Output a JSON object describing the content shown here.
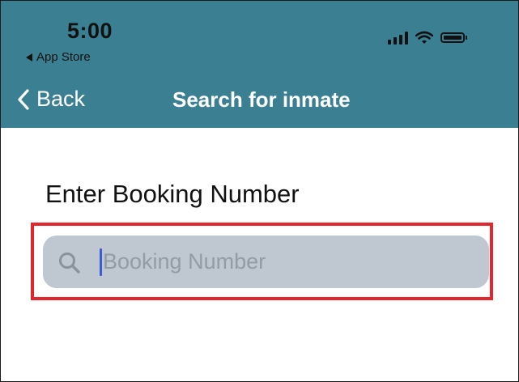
{
  "status_bar": {
    "time": "5:00",
    "back_app": "App Store"
  },
  "nav": {
    "back_label": "Back",
    "title": "Search for inmate"
  },
  "form": {
    "label": "Enter Booking Number",
    "search_placeholder": "Booking Number",
    "search_value": ""
  },
  "colors": {
    "header": "#3b8092",
    "field_background": "#bfc8d0",
    "highlight": "#e3262d",
    "caret": "#3b5bdb"
  },
  "icons": {
    "status_back": "triangle-left-icon",
    "signal": "cellular-signal-icon",
    "wifi": "wifi-icon",
    "battery": "battery-icon",
    "nav_back": "chevron-left-icon",
    "search": "magnifying-glass-icon"
  }
}
